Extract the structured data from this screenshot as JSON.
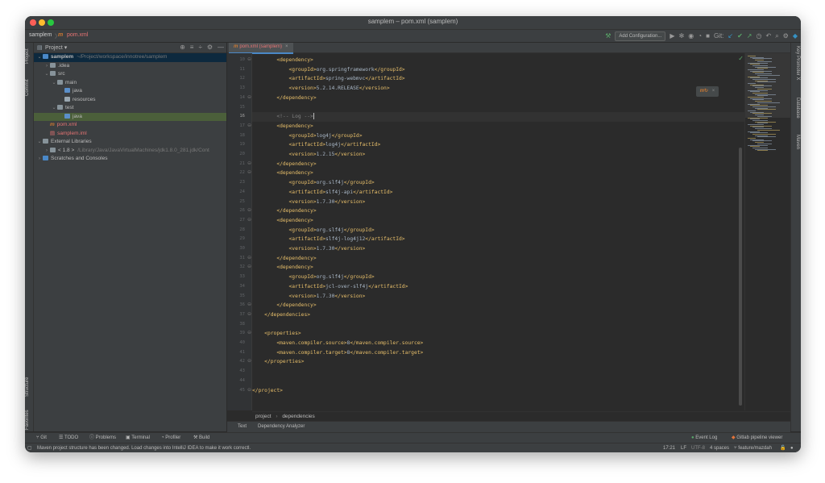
{
  "window": {
    "title": "samplem – pom.xml (samplem)"
  },
  "navbar": {
    "project": "samplem",
    "sep": "〉",
    "file_icon": "m",
    "file": "pom.xml",
    "add_configuration": "Add Configuration...",
    "git_label": "Git:"
  },
  "left_tools": {
    "project": "Project",
    "commit": "Commit",
    "structure": "Structure",
    "favorites": "Favorites"
  },
  "right_tools": {
    "key_promoter": "Key Promoter X",
    "database": "Database",
    "maven": "Maven"
  },
  "project_panel": {
    "header": "Project",
    "tree": [
      {
        "label": "samplem",
        "extra": "~/Project/workspace/innotree/samplem",
        "level": 0,
        "arrow": "⌄",
        "icon": "folder-blue",
        "selected": true
      },
      {
        "label": ".idea",
        "level": 1,
        "arrow": "›",
        "icon": "folder"
      },
      {
        "label": "src",
        "level": 1,
        "arrow": "⌄",
        "icon": "folder"
      },
      {
        "label": "main",
        "level": 2,
        "arrow": "⌄",
        "icon": "folder"
      },
      {
        "label": "java",
        "level": 3,
        "arrow": "",
        "icon": "folder-src"
      },
      {
        "label": "resources",
        "level": 3,
        "arrow": "",
        "icon": "folder-res"
      },
      {
        "label": "test",
        "level": 2,
        "arrow": "⌄",
        "icon": "folder"
      },
      {
        "label": "java",
        "level": 3,
        "arrow": "",
        "icon": "folder-test",
        "highlight": true
      },
      {
        "label": "pom.xml",
        "level": 1,
        "arrow": "",
        "icon": "maven-file",
        "red": true
      },
      {
        "label": "samplem.iml",
        "level": 1,
        "arrow": "",
        "icon": "iml-file",
        "red": true
      },
      {
        "label": "External Libraries",
        "level": 0,
        "arrow": "⌄",
        "icon": "library"
      },
      {
        "label": "< 1.8 >",
        "extra": "/Library/Java/JavaVirtualMachines/jdk1.8.0_281.jdk/Cont",
        "level": 1,
        "arrow": "›",
        "icon": "jdk"
      },
      {
        "label": "Scratches and Consoles",
        "level": 0,
        "arrow": "›",
        "icon": "scratches"
      }
    ]
  },
  "editor": {
    "tab_icon": "m",
    "tab_label": "pom.xml (samplem)",
    "lines": [
      {
        "n": "10",
        "fold": "⊖",
        "html": "        <t>&lt;dependency&gt;</t>"
      },
      {
        "n": "11",
        "html": "            <t>&lt;groupId&gt;</t><x>org.springframework</x><t>&lt;/groupId&gt;</t>"
      },
      {
        "n": "12",
        "html": "            <t>&lt;artifactId&gt;</t><x>spring-webmvc</x><t>&lt;/artifactId&gt;</t>"
      },
      {
        "n": "13",
        "html": "            <t>&lt;version&gt;</t><x>5.2.14.RELEASE</x><t>&lt;/version&gt;</t>"
      },
      {
        "n": "14",
        "fold": "⊖",
        "html": "        <t>&lt;/dependency&gt;</t>"
      },
      {
        "n": "15",
        "html": ""
      },
      {
        "n": "16",
        "html": "        <c>&lt;!-- Log --&gt;</c>",
        "cursor": true
      },
      {
        "n": "17",
        "fold": "⊖",
        "html": "        <t>&lt;dependency&gt;</t>"
      },
      {
        "n": "18",
        "html": "            <t>&lt;groupId&gt;</t><x>log4j</x><t>&lt;/groupId&gt;</t>"
      },
      {
        "n": "19",
        "html": "            <t>&lt;artifactId&gt;</t><x>log4j</x><t>&lt;/artifactId&gt;</t>"
      },
      {
        "n": "20",
        "html": "            <t>&lt;version&gt;</t><x>1.2.15</x><t>&lt;/version&gt;</t>"
      },
      {
        "n": "21",
        "fold": "⊖",
        "html": "        <t>&lt;/dependency&gt;</t>"
      },
      {
        "n": "22",
        "fold": "⊖",
        "html": "        <t>&lt;dependency&gt;</t>"
      },
      {
        "n": "23",
        "html": "            <t>&lt;groupId&gt;</t><x>org.slf4j</x><t>&lt;/groupId&gt;</t>"
      },
      {
        "n": "24",
        "html": "            <t>&lt;artifactId&gt;</t><x>slf4j-api</x><t>&lt;/artifactId&gt;</t>"
      },
      {
        "n": "25",
        "html": "            <t>&lt;version&gt;</t><x>1.7.30</x><t>&lt;/version&gt;</t>"
      },
      {
        "n": "26",
        "fold": "⊖",
        "html": "        <t>&lt;/dependency&gt;</t>"
      },
      {
        "n": "27",
        "fold": "⊖",
        "html": "        <t>&lt;dependency&gt;</t>"
      },
      {
        "n": "28",
        "html": "            <t>&lt;groupId&gt;</t><x>org.slf4j</x><t>&lt;/groupId&gt;</t>"
      },
      {
        "n": "29",
        "html": "            <t>&lt;artifactId&gt;</t><x>slf4j-log4j12</x><t>&lt;/artifactId&gt;</t>"
      },
      {
        "n": "30",
        "html": "            <t>&lt;version&gt;</t><x>1.7.30</x><t>&lt;/version&gt;</t>"
      },
      {
        "n": "31",
        "fold": "⊖",
        "html": "        <t>&lt;/dependency&gt;</t>"
      },
      {
        "n": "32",
        "fold": "⊖",
        "html": "        <t>&lt;dependency&gt;</t>"
      },
      {
        "n": "33",
        "html": "            <t>&lt;groupId&gt;</t><x>org.slf4j</x><t>&lt;/groupId&gt;</t>"
      },
      {
        "n": "34",
        "html": "            <t>&lt;artifactId&gt;</t><x>jcl-over-slf4j</x><t>&lt;/artifactId&gt;</t>"
      },
      {
        "n": "35",
        "html": "            <t>&lt;version&gt;</t><x>1.7.30</x><t>&lt;/version&gt;</t>"
      },
      {
        "n": "36",
        "fold": "⊖",
        "html": "        <t>&lt;/dependency&gt;</t>"
      },
      {
        "n": "37",
        "fold": "⊖",
        "html": "    <t>&lt;/dependencies&gt;</t>"
      },
      {
        "n": "38",
        "html": ""
      },
      {
        "n": "39",
        "fold": "⊖",
        "html": "    <t>&lt;properties&gt;</t>"
      },
      {
        "n": "40",
        "html": "        <t>&lt;maven.compiler.source&gt;</t><x>8</x><t>&lt;/maven.compiler.source&gt;</t>"
      },
      {
        "n": "41",
        "html": "        <t>&lt;maven.compiler.target&gt;</t><x>8</x><t>&lt;/maven.compiler.target&gt;</t>"
      },
      {
        "n": "42",
        "fold": "⊖",
        "html": "    <t>&lt;/properties&gt;</t>"
      },
      {
        "n": "43",
        "html": ""
      },
      {
        "n": "44",
        "html": ""
      },
      {
        "n": "45",
        "fold": "⊖",
        "html": "<t>&lt;/project&gt;</t>"
      }
    ],
    "breadcrumbs": [
      "project",
      "dependencies"
    ],
    "bottom_tabs": [
      "Text",
      "Dependency Analyzer"
    ]
  },
  "toolwindows": {
    "git": "Git",
    "todo": "TODO",
    "problems": "Problems",
    "terminal": "Terminal",
    "profiler": "Profiler",
    "build": "Build",
    "event_log": "Event Log",
    "gitlab": "Gitlab pipeline viewer"
  },
  "status": {
    "message": "Maven project structure has been changed. Load changes into IntelliJ IDEA to make it work correctl.",
    "position": "17:21",
    "line_sep": "LF",
    "encoding": "UTF-8",
    "indent": "4 spaces",
    "branch": "feature/mazdah"
  },
  "colors": {
    "tag": "#e8bf6a",
    "text": "#a9b7c6",
    "comment": "#808080",
    "accent": "#4a88c7",
    "bg": "#2b2b2b"
  }
}
